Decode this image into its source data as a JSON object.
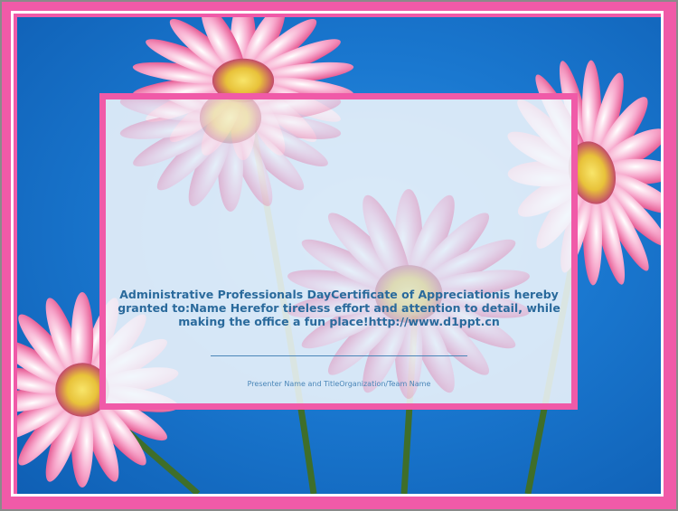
{
  "certificate": {
    "body_text": "Administrative Professionals DayCertificate of Appreciationis hereby granted to:Name Herefor tireless effort and attention to detail, while making the office a fun place!http://www.d1ppt.cn",
    "presenter_label": "Presenter Name and TitleOrganization/Team Name"
  },
  "colors": {
    "frame_pink": "#f05aa8",
    "background_blue": "#1a78d0",
    "text_blue": "#2a6a9c"
  }
}
